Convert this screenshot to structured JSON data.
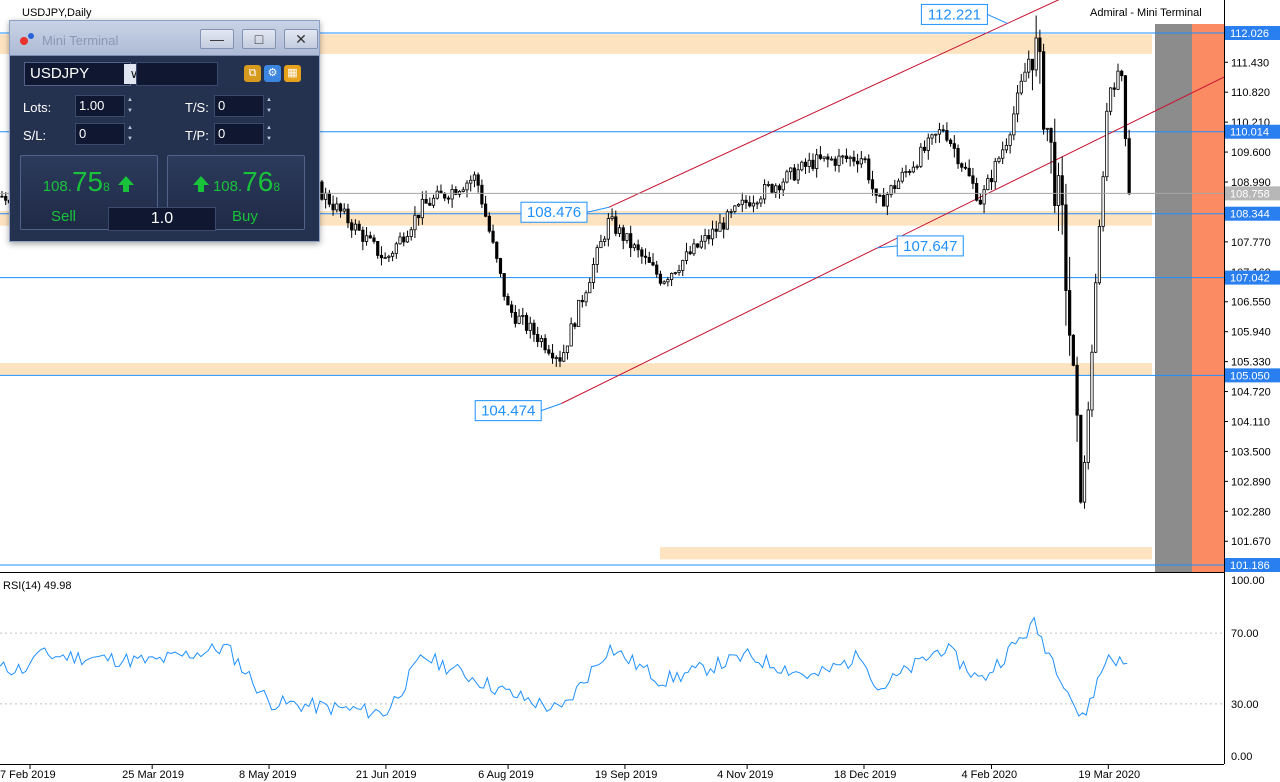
{
  "chart_title": "USDJPY,Daily",
  "indicator_label": "Admiral - Mini Terminal",
  "colors": {
    "price_line": "#1e90ff",
    "zone": "#fde3c0",
    "channel": "#c8102e",
    "candle": "#000000",
    "rsi": "#1e90ff",
    "future_gray": "#8c8c8c",
    "future_orange": "#fa8b63",
    "label_bg_blue": "#2a7ff0"
  },
  "chart_data": [
    {
      "type": "candlestick",
      "x_ticks": [
        "7 Feb 2019",
        "25 Mar 2019",
        "8 May 2019",
        "21 Jun 2019",
        "6 Aug 2019",
        "19 Sep 2019",
        "4 Nov 2019",
        "18 Dec 2019",
        "4 Feb 2020",
        "19 Mar 2020"
      ],
      "y_ticks": [
        "112.026",
        "111.430",
        "110.820",
        "110.210",
        "109.600",
        "108.990",
        "108.380",
        "107.770",
        "107.160",
        "106.550",
        "105.940",
        "105.330",
        "104.720",
        "104.110",
        "103.500",
        "102.890",
        "102.280",
        "101.670"
      ],
      "ylim": [
        101.186,
        112.6
      ],
      "current_price": 108.758,
      "levels": [
        112.026,
        110.014,
        108.344,
        107.042,
        105.05,
        101.186
      ],
      "zones": [
        {
          "low": 111.6,
          "high": 112.0
        },
        {
          "low": 108.1,
          "high": 108.4
        },
        {
          "low": 105.05,
          "high": 105.3
        },
        {
          "low": 101.3,
          "high": 101.55
        }
      ],
      "annotations": [
        {
          "text": "112.221",
          "x": "10 Feb 2020",
          "value": 112.221
        },
        {
          "text": "108.476",
          "x": "13 Sep 2019",
          "value": 108.476
        },
        {
          "text": "107.647",
          "x": "23 Dec 2019",
          "value": 107.647
        },
        {
          "text": "104.474",
          "x": "26 Aug 2019",
          "value": 104.474
        }
      ],
      "channel_lines": [
        {
          "from_value": 104.474,
          "to_value": 112.221
        },
        {
          "from_value": 108.476,
          "to_value": 110.6
        }
      ],
      "close_path": [
        {
          "x": "7 Feb 2019",
          "value": 110.6
        },
        {
          "x": "25 Mar 2019",
          "value": 110.1
        },
        {
          "x": "22 Apr 2019",
          "value": 111.8
        },
        {
          "x": "8 May 2019",
          "value": 109.9
        },
        {
          "x": "21 Jun 2019",
          "value": 107.4
        },
        {
          "x": "5 Jul 2019",
          "value": 108.5
        },
        {
          "x": "25 Jul 2019",
          "value": 109.1
        },
        {
          "x": "6 Aug 2019",
          "value": 106.4
        },
        {
          "x": "26 Aug 2019",
          "value": 105.4
        },
        {
          "x": "13 Sep 2019",
          "value": 108.2
        },
        {
          "x": "3 Oct 2019",
          "value": 107.0
        },
        {
          "x": "4 Nov 2019",
          "value": 108.6
        },
        {
          "x": "29 Nov 2019",
          "value": 109.4
        },
        {
          "x": "18 Dec 2019",
          "value": 109.5
        },
        {
          "x": "23 Dec 2019",
          "value": 108.5
        },
        {
          "x": "17 Jan 2020",
          "value": 110.1
        },
        {
          "x": "31 Jan 2020",
          "value": 108.6
        },
        {
          "x": "10 Feb 2020",
          "value": 109.9
        },
        {
          "x": "20 Feb 2020",
          "value": 111.9
        },
        {
          "x": "2 Mar 2020",
          "value": 107.9
        },
        {
          "x": "9 Mar 2020",
          "value": 102.3
        },
        {
          "x": "19 Mar 2020",
          "value": 110.9
        },
        {
          "x": "24 Mar 2020",
          "value": 111.2
        },
        {
          "x": "27 Mar 2020",
          "value": 108.7
        }
      ]
    },
    {
      "type": "line",
      "title": "RSI(14) 49.98",
      "series": [
        {
          "name": "RSI(14)"
        }
      ],
      "y_ticks": [
        "100.00",
        "70.00",
        "30.00",
        "0.00"
      ],
      "ylim": [
        0,
        100
      ],
      "levels": [
        70,
        30
      ],
      "x": [
        "7 Feb 2019",
        "25 Mar 2019",
        "22 Apr 2019",
        "8 May 2019",
        "21 Jun 2019",
        "5 Jul 2019",
        "6 Aug 2019",
        "26 Aug 2019",
        "13 Sep 2019",
        "3 Oct 2019",
        "4 Nov 2019",
        "29 Nov 2019",
        "18 Dec 2019",
        "23 Dec 2019",
        "17 Jan 2020",
        "31 Jan 2020",
        "20 Feb 2020",
        "2 Mar 2020",
        "9 Mar 2020",
        "19 Mar 2020",
        "27 Mar 2020"
      ],
      "values": [
        58,
        54,
        62,
        31,
        25,
        57,
        36,
        26,
        62,
        43,
        57,
        45,
        58,
        38,
        62,
        43,
        75,
        44,
        20,
        58,
        50
      ]
    }
  ],
  "mini_terminal": {
    "title": "Mini Terminal",
    "symbol": "USDJPY",
    "lots_label": "Lots:",
    "lots_value": "1.00",
    "ts_label": "T/S:",
    "ts_value": "0",
    "sl_label": "S/L:",
    "sl_value": "0",
    "tp_label": "T/P:",
    "tp_value": "0",
    "sell": {
      "label": "Sell",
      "price_small": "108.",
      "price_big": "75",
      "price_tiny": "8"
    },
    "buy": {
      "label": "Buy",
      "price_small": "108.",
      "price_big": "76",
      "price_tiny": "8"
    },
    "volume": "1.0",
    "icons": [
      "copy-icon",
      "gear-icon",
      "expand-icon",
      "minimize-icon",
      "maximize-icon",
      "close-icon",
      "up-arrow-icon"
    ]
  }
}
